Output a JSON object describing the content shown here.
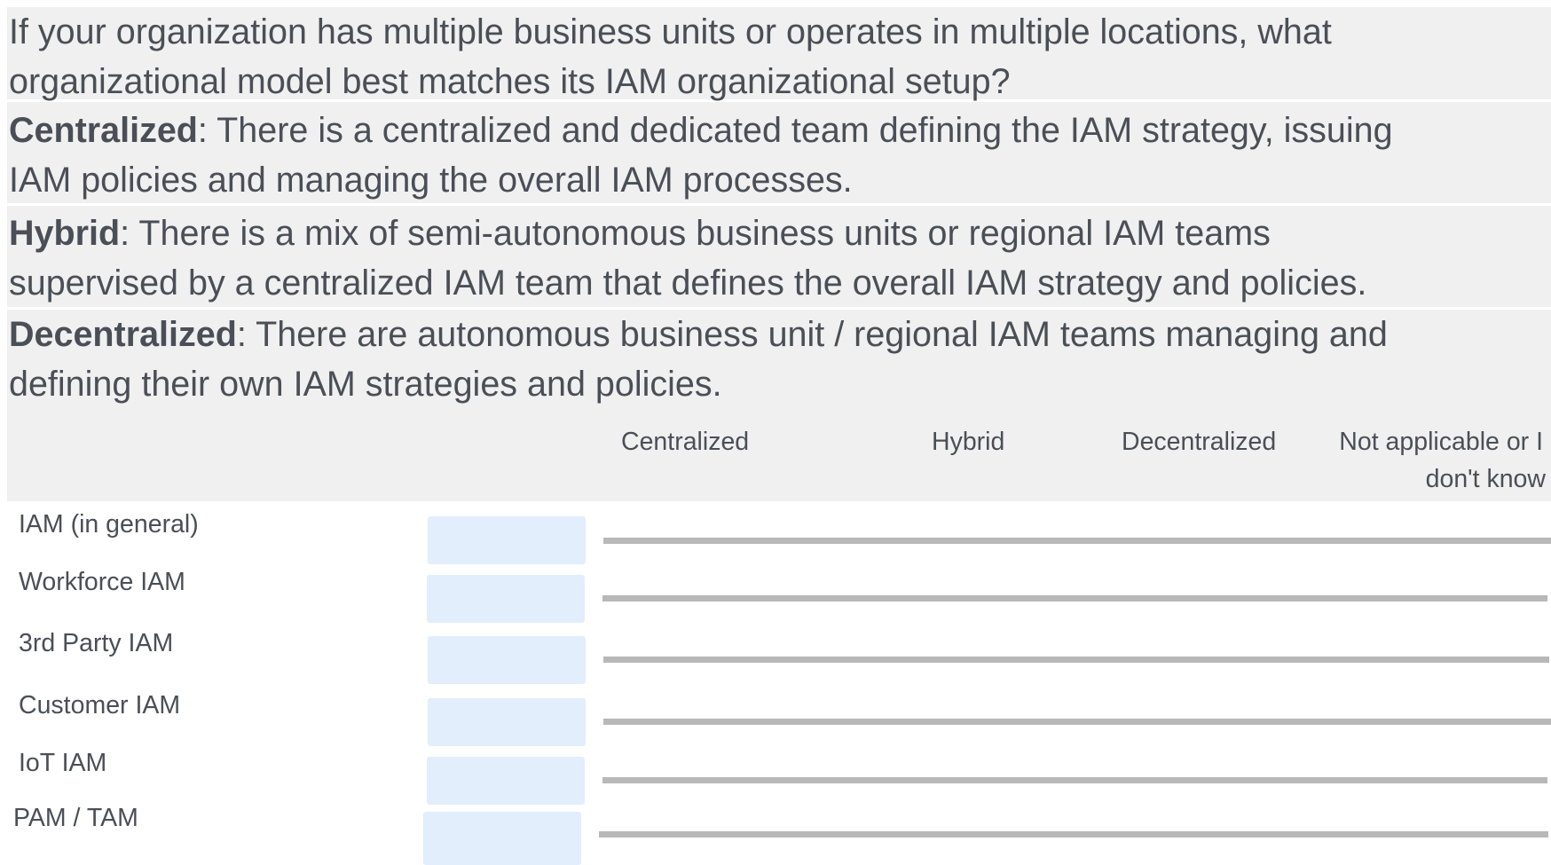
{
  "question": "If your organization has multiple business units or operates in multiple locations, what organizational model best matches its IAM organizational setup?",
  "question_lines": [
    "If your organization has multiple business units or operates in multiple locations, what",
    "organizational model best matches its IAM organizational setup?"
  ],
  "definitions": [
    {
      "term": "Centralized",
      "lines": [
        ": There is a centralized and dedicated team defining the IAM strategy, issuing",
        "IAM policies and managing the overall IAM processes."
      ]
    },
    {
      "term": "Hybrid",
      "lines": [
        ": There is a mix of semi-autonomous business units or regional IAM teams",
        "supervised by a centralized IAM team that defines the overall IAM strategy and policies."
      ]
    },
    {
      "term": "Decentralized",
      "lines": [
        ": There are autonomous business unit / regional IAM teams managing and",
        "defining their own IAM strategies and policies."
      ]
    }
  ],
  "columns": [
    "Centralized",
    "Hybrid",
    "Decentralized",
    "Not applicable or I",
    "don't know"
  ],
  "rows": [
    {
      "label": "IAM (in general)"
    },
    {
      "label": "Workforce IAM"
    },
    {
      "label": "3rd Party IAM"
    },
    {
      "label": "Customer IAM"
    },
    {
      "label": "IoT IAM"
    },
    {
      "label": "PAM / TAM"
    }
  ],
  "colors": {
    "band": "#f0f0f0",
    "box": "#e2eefc",
    "track": "#b8b8b8",
    "text": "#4a4f57"
  }
}
